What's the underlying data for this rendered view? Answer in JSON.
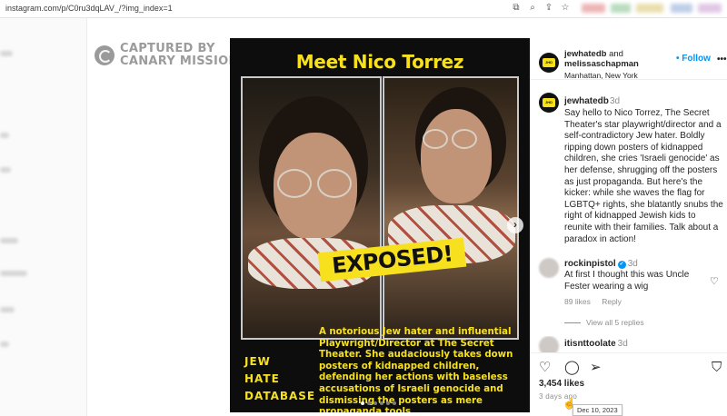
{
  "browser": {
    "url": "instagram.com/p/C0ru3dqLAV_/?img_index=1",
    "icons": [
      "open-in-app-icon",
      "zoom-icon",
      "share-icon",
      "bookmark-star-icon"
    ],
    "icon_glyphs": [
      "⧉",
      "⌕",
      "⇪",
      "☆"
    ]
  },
  "watermark": {
    "line1": "CAPTURED BY",
    "line2": "CANARY MISSION"
  },
  "post_image": {
    "title": "Meet Nico Torrez",
    "banner": "EXPOSED!",
    "caption": "A notorious Jew hater and influential Playwright/Director at The Secret Theater. She audaciously takes down posters of kidnapped children, defending her actions with baseless accusations of Israeli genocide and dismissing the posters as mere propaganda tools.",
    "logo_lines": [
      "JEW",
      "HATE",
      "DATABASE"
    ],
    "next_glyph": "›",
    "slide_count": 6,
    "active_slide": 1,
    "accent_color": "#f7e11f"
  },
  "header": {
    "user1": "jewhatedb",
    "and": " and",
    "user2": "melissaschapman",
    "location": "Manhattan, New York",
    "follow_label": "• Follow",
    "more_glyph": "•••"
  },
  "caption": {
    "username": "jewhatedb",
    "time": "3d",
    "text": "Say hello to Nico Torrez, The Secret Theater's star playwright/director and a self-contradictory Jew hater. Boldly ripping down posters of kidnapped children, she cries 'Israeli genocide' as her defense, shrugging off the posters as just propaganda. But here's the kicker: while she waves the flag for LGBTQ+ rights, she blatantly snubs the right of kidnapped Jewish kids to reunite with their families. Talk about a paradox in action!"
  },
  "comments": [
    {
      "username": "rockinpistol",
      "verified_glyph": "✓",
      "time": "3d",
      "text": "At first I thought this was Uncle Fester wearing a wig",
      "likes": "89 likes",
      "reply": "Reply",
      "view_replies": "View all 5 replies"
    },
    {
      "username": "itisnttoolate",
      "time": "3d"
    }
  ],
  "actions": {
    "like_glyph": "♡",
    "comment_glyph": "◯",
    "share_glyph": "➢",
    "save_glyph": "⛉",
    "likes": "3,454 likes",
    "ago": "3 days ago",
    "tooltip": "Dec 10, 2023"
  }
}
